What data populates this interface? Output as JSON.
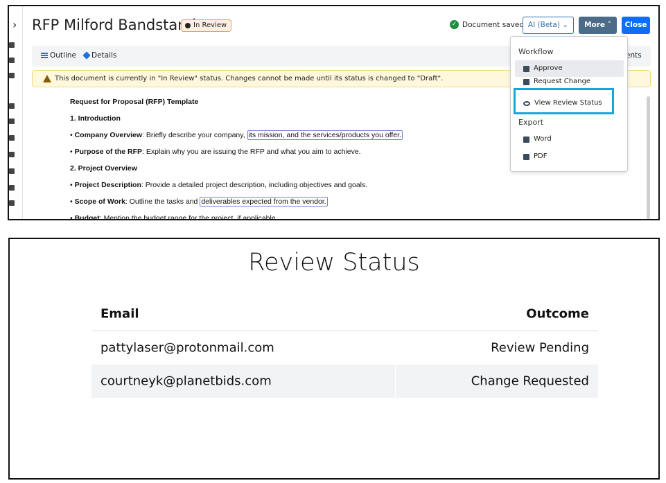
{
  "editor": {
    "doc_title": "RFP Milford Bandstand",
    "status_badge": "In Review",
    "saved_text": "Document saved.",
    "ai_button": "AI (Beta)",
    "more_button": "More",
    "close_button": "Close",
    "tabs": {
      "outline": "Outline",
      "details": "Details",
      "comments": "ents"
    },
    "warning": "This document is currently in \"In Review\" status. Changes cannot be made until its status is changed to \"Draft\".",
    "body": {
      "line1": "Request for Proposal (RFP) Template",
      "line2": "1. Introduction",
      "line3_bold": "Company Overview",
      "line3_text": ": Briefly describe your company,",
      "line3_hl": "its mission, and the services/products you offer.",
      "line4_bold": "Purpose of the RFP",
      "line4_text": ": Explain why you are issuing the RFP and what you aim to achieve.",
      "line5": "2. Project Overview",
      "line6_bold": "Project Description",
      "line6_text": ": Provide a detailed project description, including objectives and goals.",
      "line7_bold": "Scope of Work",
      "line7_text": ": Outline the tasks and",
      "line7_hl": "deliverables expected from the vendor.",
      "line8_bold": "Budget",
      "line8_text": ": Mention the budget range for the project, if applicable."
    },
    "dropdown": {
      "workflow_header": "Workflow",
      "approve": "Approve",
      "request_change": "Request Change",
      "view_review_status": "View Review Status",
      "export_header": "Export",
      "word": "Word",
      "pdf": "PDF"
    }
  },
  "review": {
    "title": "Review Status",
    "col_email": "Email",
    "col_outcome": "Outcome",
    "rows": [
      {
        "email": "pattylaser@protonmail.com",
        "outcome": "Review Pending"
      },
      {
        "email": "courtneyk@planetbids.com",
        "outcome": "Change Requested"
      }
    ]
  },
  "colors": {
    "primary": "#0d6efd",
    "more_btn": "#4b6b88",
    "highlight_box": "#12a9d8",
    "saved_check": "#1e8e3e"
  }
}
